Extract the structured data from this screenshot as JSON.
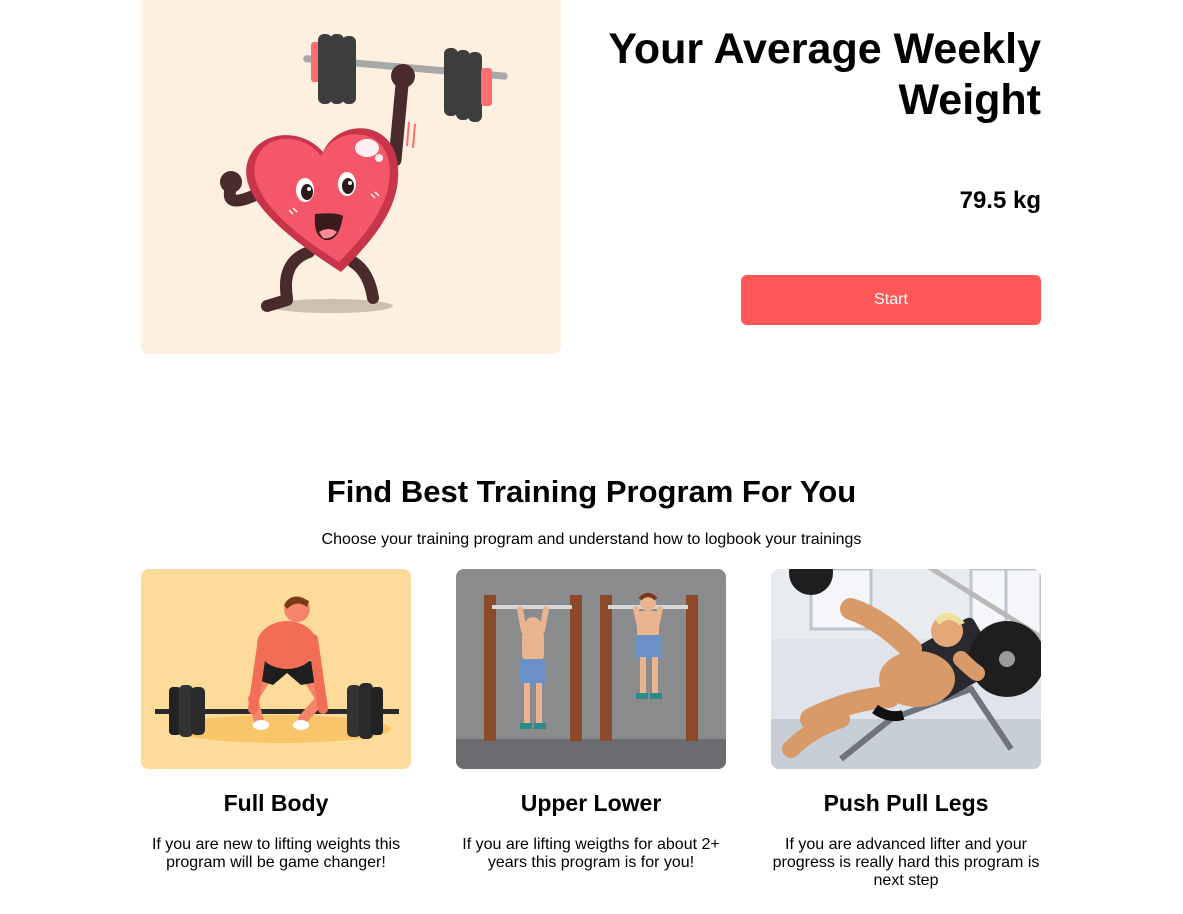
{
  "hero": {
    "title": "Your Average Weekly Weight",
    "weight": "79.5 kg",
    "start_label": "Start",
    "illustration": "heart-lifting-barbell-illustration"
  },
  "programs": {
    "title": "Find Best Training Program For You",
    "subtitle": "Choose your training program and understand how to logbook your trainings",
    "items": [
      {
        "title": "Full Body",
        "description": "If you are new to lifting weights this program will be game changer!",
        "image": "deadlift-illustration"
      },
      {
        "title": "Upper Lower",
        "description": "If you are lifting weigths for about 2+ years this program is for you!",
        "image": "pull-up-illustration"
      },
      {
        "title": "Push Pull Legs",
        "description": "If you are advanced lifter and your progress is really hard this program is next step",
        "image": "bench-press-illustration"
      }
    ]
  },
  "colors": {
    "accent": "#ff5757",
    "hero_background": "#fdf0e1",
    "card1_background": "#fddc9b",
    "card2_background": "#8a8b8d"
  }
}
